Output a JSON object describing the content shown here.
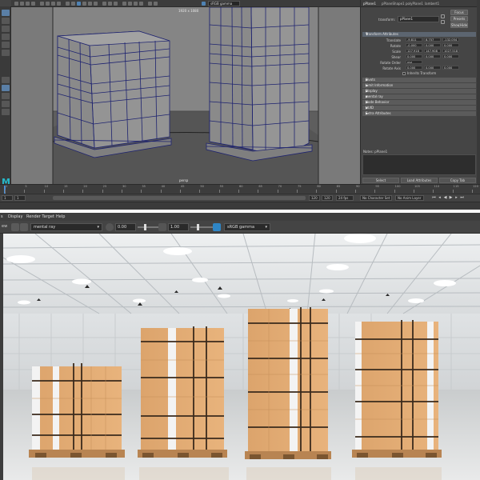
{
  "maya": {
    "resolution_label": "1920 x 1080",
    "camera_label": "persp",
    "viewport_field": "sRGB gamma",
    "attribute_editor": {
      "tabs": [
        "pPlane1",
        "pPlaneShape1",
        "polyPlane1",
        "lambert1"
      ],
      "focus_label": "Focus",
      "presets_label": "Presets",
      "show_label": "Show",
      "hide_label": "Hide",
      "type_label": "transform:",
      "node_name": "pPlane1",
      "sections": {
        "transform": "Transform Attributes",
        "pivots": "Pivots",
        "limit": "Limit Information",
        "display": "Display",
        "mental_ray": "mental ray",
        "node_behavior": "Node Behavior",
        "uuid": "UUID",
        "extra": "Extra Attributes"
      },
      "transform_rows": [
        {
          "label": "Translate",
          "values": [
            "-9.811",
            "8.757",
            "-132.054"
          ]
        },
        {
          "label": "Rotate",
          "values": [
            "-0.000",
            "0.000",
            "0.000"
          ]
        },
        {
          "label": "Scale",
          "values": [
            "127.918",
            "147.908",
            "1027.518"
          ]
        },
        {
          "label": "Shear",
          "values": [
            "0.000",
            "0.000",
            "0.000"
          ]
        },
        {
          "label": "Rotate Order",
          "values": [
            "xyz"
          ]
        },
        {
          "label": "Rotate Axis",
          "values": [
            "0.000",
            "0.000",
            "0.000"
          ]
        }
      ],
      "inherits_label": "Inherits Transform",
      "notes_label": "Notes: pPlane1",
      "bottom_buttons": [
        "Select",
        "Load Attributes",
        "Copy Tab"
      ]
    },
    "timeline": {
      "ticks": [
        "1",
        "5",
        "10",
        "15",
        "20",
        "25",
        "30",
        "35",
        "40",
        "45",
        "50",
        "55",
        "60",
        "65",
        "70",
        "75",
        "80",
        "85",
        "90",
        "95",
        "100",
        "105",
        "110",
        "115",
        "120"
      ],
      "start": "1",
      "end": "120",
      "range_start": "1",
      "range_end": "120",
      "fps": "24 fps",
      "char_set": "No Character Set",
      "anim_layer": "No Anim Layer"
    }
  },
  "render_view": {
    "menus": [
      "File",
      "View",
      "Render",
      "Options",
      "Display",
      "Render Target",
      "Help"
    ],
    "visible_menus": [
      "s",
      "Display",
      "Render Target",
      "Help"
    ],
    "renderer": "mental ray",
    "exposure": "0.00",
    "gamma": "1.00",
    "color_space": "sRGB gamma",
    "tool_label": "ew"
  },
  "colors": {
    "maya_bg": "#444444",
    "viewport_bg": "#7a7a7a",
    "accent": "#4f82b3",
    "cardboard": "#d9a066",
    "pallet": "#b88452"
  }
}
